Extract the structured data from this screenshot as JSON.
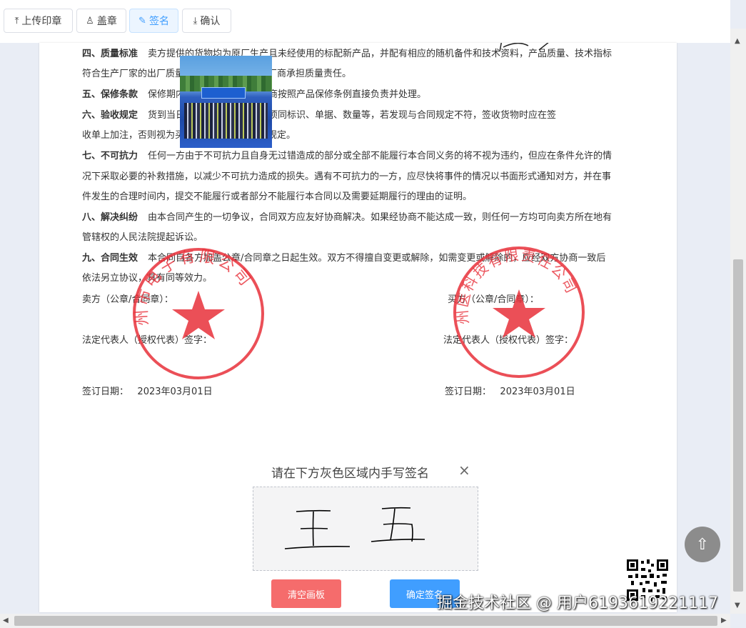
{
  "toolbar": {
    "upload_stamp": "上传印章",
    "stamp": "盖章",
    "sign": "签名",
    "confirm": "确认"
  },
  "contract": {
    "lines": [
      {
        "head": "四、质量标准",
        "text": "卖方提供的货物均为原厂生产且未经使用的标配新产品，并配有相应的随机备件和技术资料，产品质量、技术指标"
      },
      {
        "head": "",
        "text": "符合生产厂家的出厂质量标准。该产品由生产厂商承担质量责任。"
      },
      {
        "head": "五、保修条款",
        "text": "保修期内的售后服务均由原厂商按照产品保修条例直接负责并处理。"
      },
      {
        "head": "六、验收规定",
        "text": "货到当日，买方应检查产品各项同标识、单据、数量等，若发现与合同规定不符，签收货物时应在签"
      },
      {
        "head": "",
        "text": "收单上加注，否则视为买方确认货物符合合同规定。"
      },
      {
        "head": "七、不可抗力",
        "text": "任何一方由于不可抗力且自身无过错造成的部分或全部不能履行本合同义务的将不视为违约，但应在条件允许的情"
      },
      {
        "head": "",
        "text": "况下采取必要的补救措施，以减少不可抗力造成的损失。遇有不可抗力的一方，应尽快将事件的情况以书面形式通知对方，并在事"
      },
      {
        "head": "",
        "text": "件发生的合理时间内，提交不能履行或者部分不能履行本合同以及需要延期履行的理由的证明。"
      },
      {
        "head": "八、解决纠纷",
        "text": "由本合同产生的一切争议，合同双方应友好协商解决。如果经协商不能达成一致，则任何一方均可向卖方所在地有"
      },
      {
        "head": "",
        "text": "管辖权的人民法院提起诉讼。"
      },
      {
        "head": "九、合同生效",
        "text": "本合同自各方加盖公章/合同章之日起生效。双方不得擅自变更或解除，如需变更或解除的，应经双方协商一致后"
      },
      {
        "head": "",
        "text": "依法另立协议，具有同等效力。"
      }
    ],
    "seller_seal": "卖方（公章/合同章）：",
    "buyer_seal": "买方（公章/合同章）：",
    "legal_rep": "法定代表人（授权代表）签字：",
    "sign_date_label": "签订日期：",
    "seller_date": "2023年03月01日",
    "buyer_date": "2023年03月01日"
  },
  "stamps": {
    "color": "#e8303a",
    "seller_text": "州市电子有限公司",
    "buyer_text": "州医科技有限责任公司"
  },
  "signature_dialog": {
    "title": "请在下方灰色区域内手写签名",
    "close": "×",
    "clear": "清空画板",
    "confirm": "确定签名"
  },
  "watermark": "掘金技术社区 @ 用户6193619221117",
  "colors": {
    "primary": "#409eff",
    "danger": "#f56c6c",
    "seal_red": "#e8303a"
  }
}
